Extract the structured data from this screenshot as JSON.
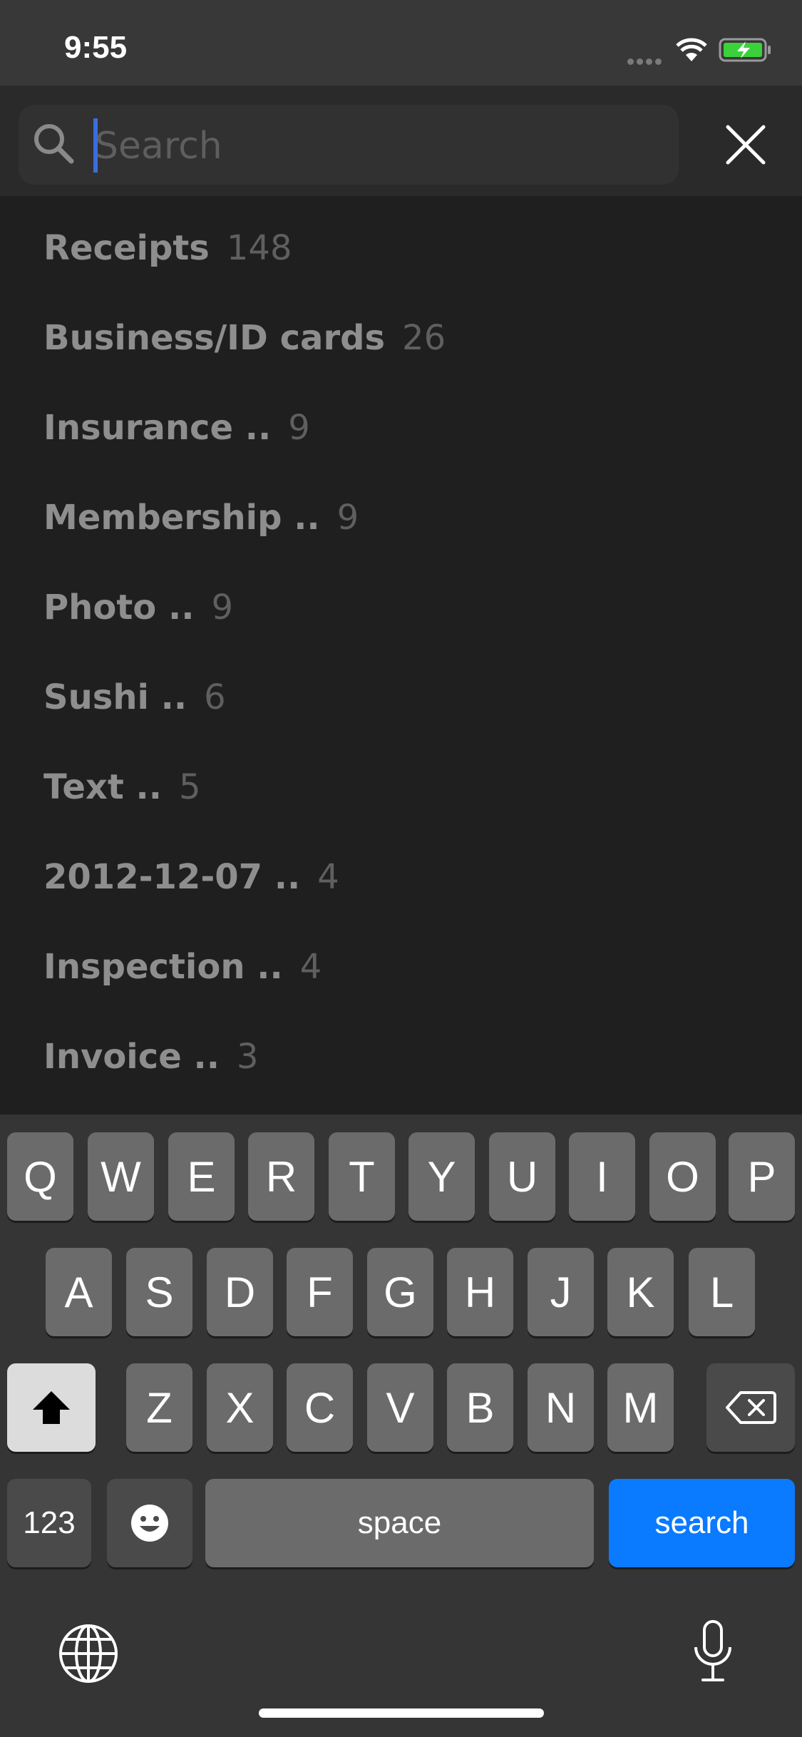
{
  "status": {
    "time": "9:55"
  },
  "search": {
    "placeholder": "Search",
    "value": ""
  },
  "suggestions": [
    {
      "label": "Receipts",
      "count": "148"
    },
    {
      "label": "Business/ID cards",
      "count": "26"
    },
    {
      "label": "Insurance ..",
      "count": "9"
    },
    {
      "label": "Membership ..",
      "count": "9"
    },
    {
      "label": "Photo ..",
      "count": "9"
    },
    {
      "label": "Sushi ..",
      "count": "6"
    },
    {
      "label": "Text ..",
      "count": "5"
    },
    {
      "label": "2012-12-07 ..",
      "count": "4"
    },
    {
      "label": "Inspection ..",
      "count": "4"
    },
    {
      "label": "Invoice ..",
      "count": "3"
    }
  ],
  "keyboard": {
    "row1": [
      "Q",
      "W",
      "E",
      "R",
      "T",
      "Y",
      "U",
      "I",
      "O",
      "P"
    ],
    "row2": [
      "A",
      "S",
      "D",
      "F",
      "G",
      "H",
      "J",
      "K",
      "L"
    ],
    "row3": [
      "Z",
      "X",
      "C",
      "V",
      "B",
      "N",
      "M"
    ],
    "numbers_label": "123",
    "space_label": "space",
    "search_label": "search"
  },
  "colors": {
    "accent": "#0a7aff",
    "background": "#1f1f1f",
    "keyboard": "#353535"
  },
  "icons": [
    "search-icon",
    "close-icon",
    "wifi-icon",
    "battery-icon",
    "shift-icon",
    "delete-icon",
    "emoji-icon",
    "globe-icon",
    "mic-icon"
  ]
}
